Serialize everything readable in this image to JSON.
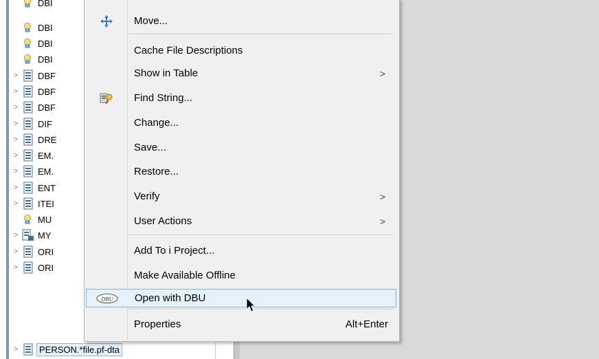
{
  "tree": {
    "items": [
      {
        "label": "DBI",
        "expandable": false,
        "icon": "lightbulb-icon"
      },
      {
        "label": "DBI",
        "expandable": false,
        "icon": "lightbulb-icon"
      },
      {
        "label": "DBI",
        "expandable": false,
        "icon": "lightbulb-icon"
      },
      {
        "label": "DBI",
        "expandable": false,
        "icon": "lightbulb-icon"
      },
      {
        "label": "DBF",
        "expandable": true,
        "icon": "file-icon"
      },
      {
        "label": "DBF",
        "expandable": true,
        "icon": "file-icon"
      },
      {
        "label": "DBF",
        "expandable": true,
        "icon": "file-icon"
      },
      {
        "label": "DIF",
        "expandable": true,
        "icon": "file-icon"
      },
      {
        "label": "DRE",
        "expandable": true,
        "icon": "file-icon"
      },
      {
        "label": "EM.",
        "expandable": true,
        "icon": "file-icon"
      },
      {
        "label": "EM.",
        "expandable": true,
        "icon": "file-icon"
      },
      {
        "label": "ENT",
        "expandable": true,
        "icon": "file-icon"
      },
      {
        "label": "ITEI",
        "expandable": true,
        "icon": "file-icon"
      },
      {
        "label": "MU",
        "expandable": false,
        "icon": "lightbulb-icon"
      },
      {
        "label": "MY",
        "expandable": true,
        "icon": "logical-file-icon"
      },
      {
        "label": "ORI",
        "expandable": true,
        "icon": "file-icon"
      },
      {
        "label": "ORI",
        "expandable": true,
        "icon": "file-icon"
      },
      {
        "label": "PERSON.*file.pf-dta",
        "expandable": true,
        "icon": "file-icon",
        "selected": true
      }
    ]
  },
  "menu": {
    "items": [
      {
        "label": "Move...",
        "icon": "move-icon"
      },
      {
        "label": "Cache File Descriptions"
      },
      {
        "label": "Show in Table",
        "submenu": ">"
      },
      {
        "label": "Find String...",
        "icon": "find-string-icon"
      },
      {
        "label": "Change..."
      },
      {
        "label": "Save..."
      },
      {
        "label": "Restore..."
      },
      {
        "label": "Verify",
        "submenu": ">"
      },
      {
        "label": "User Actions",
        "submenu": ">"
      },
      {
        "label": "Add To i Project..."
      },
      {
        "label": "Make Available Offline"
      },
      {
        "label": "Open with DBU",
        "icon": "dbu-icon",
        "icon_text": "DBU",
        "highlighted": true
      },
      {
        "label": "Properties",
        "shortcut": "Alt+Enter"
      }
    ]
  },
  "colors": {
    "menu_bg": "#f0f0f0",
    "highlight_bg": "#e5f1fb",
    "highlight_border": "#84b1e0",
    "tree_accent": "#7e96b8"
  }
}
